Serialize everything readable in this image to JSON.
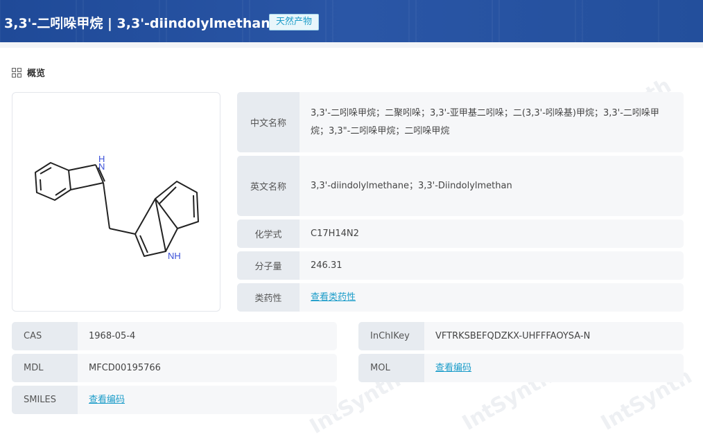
{
  "header": {
    "title": "3,3'-二吲哚甲烷 | 3,3'-diindolylmethane",
    "badge": "天然产物"
  },
  "section": {
    "title": "概览",
    "icon": "grid-icon"
  },
  "structure": {
    "atom_labels": [
      "H",
      "N",
      "NH"
    ]
  },
  "info_rows": [
    {
      "key": "中文名称",
      "value": "3,3'-二吲哚甲烷；二聚吲哚；3,3'-亚甲基二吲哚；二(3,3'-吲哚基)甲烷；3,3'-二吲哚甲烷；3,3\"-二吲哚甲烷；二吲哚甲烷"
    },
    {
      "key": "英文名称",
      "value": "3,3'-diindolylmethane；3,3'-Diindolylmethan"
    },
    {
      "key": "化学式",
      "value": "C17H14N2"
    },
    {
      "key": "分子量",
      "value": "246.31"
    },
    {
      "key": "类药性",
      "value": "查看类药性"
    }
  ],
  "id_rows_left": [
    {
      "key": "CAS",
      "value": "1968-05-4"
    },
    {
      "key": "MDL",
      "value": "MFCD00195766"
    },
    {
      "key": "SMILES",
      "value": "查看编码"
    }
  ],
  "id_rows_right": [
    {
      "key": "InChIKey",
      "value": "VFTRKSBEFQDZKX-UHFFFAOYSA-N"
    },
    {
      "key": "MOL",
      "value": "查看编码"
    }
  ],
  "colors": {
    "header_bg": "#234f9c",
    "badge_text": "#1b9cc9",
    "link": "#1b9cc9",
    "key_bg": "#e7ebf0",
    "value_bg": "#f6f7f9"
  }
}
